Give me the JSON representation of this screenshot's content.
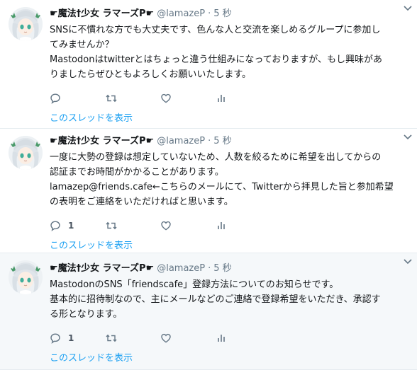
{
  "tweets": [
    {
      "name": "☛魔法†少女 ラマーズP☛",
      "handle": "@lamazeP",
      "separator": "·",
      "time": "5 秒",
      "lines": [
        "SNSに不慣れな方でも大丈夫です、色んな人と交流を楽しめるグループに参加し",
        "てみませんか？",
        "Mastodonはtwitterとはちょっと違う仕組みになっておりますが、もし興味があ",
        "りましたらぜひともよろしくお願いいたします。"
      ],
      "reply_count": "",
      "thread_link": "このスレッドを表示",
      "highlighted": false
    },
    {
      "name": "☛魔法†少女 ラマーズP☛",
      "handle": "@lamazeP",
      "separator": "·",
      "time": "5 秒",
      "lines": [
        "一度に大勢の登録は想定していないため、人数を絞るために希望を出してからの",
        "認証までお時間がかかることがあります。",
        "lamazep@friends.cafe←こちらのメールにて、Twitterから拝見した旨と参加希望",
        "の表明をご連絡をいただければと思います。"
      ],
      "reply_count": "1",
      "thread_link": "このスレッドを表示",
      "highlighted": false
    },
    {
      "name": "☛魔法†少女 ラマーズP☛",
      "handle": "@lamazeP",
      "separator": "·",
      "time": "5 秒",
      "lines": [
        "MastodonのSNS「friendscafe」登録方法についてのお知らせです。",
        "基本的に招待制なので、主にメールなどのご連絡で登録希望をいただき、承認す",
        "る形となります。"
      ],
      "reply_count": "1",
      "thread_link": "このスレッドを表示",
      "highlighted": true
    }
  ],
  "colors": {
    "link": "#1da1f2",
    "muted": "#657786",
    "divider": "#e6ecf0",
    "highlight_bg": "#f5f8fa"
  },
  "icons": [
    "avatar-anime-girl",
    "reply-icon",
    "retweet-icon",
    "like-icon",
    "analytics-icon",
    "caret-down-icon"
  ]
}
